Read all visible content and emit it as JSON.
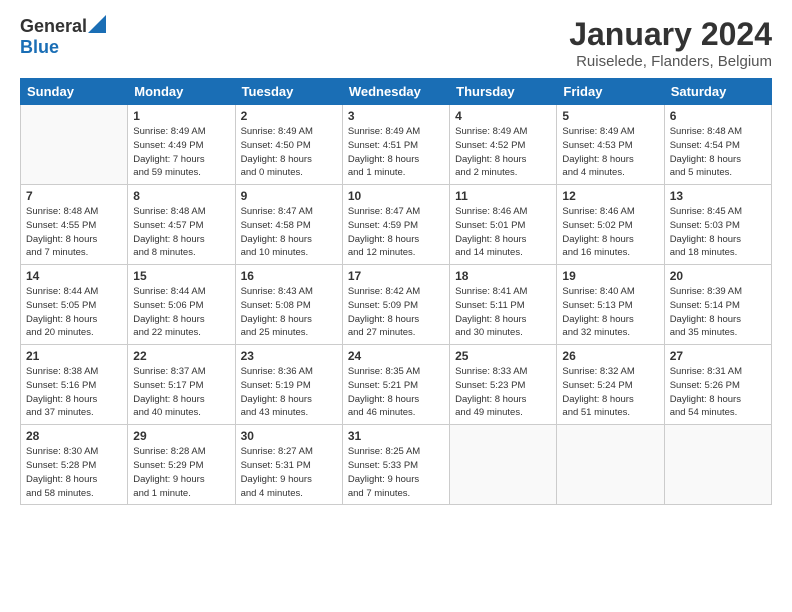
{
  "logo": {
    "line1": "General",
    "line2": "Blue"
  },
  "title": "January 2024",
  "subtitle": "Ruiselede, Flanders, Belgium",
  "days": [
    "Sunday",
    "Monday",
    "Tuesday",
    "Wednesday",
    "Thursday",
    "Friday",
    "Saturday"
  ],
  "weeks": [
    [
      {
        "day": "",
        "info": ""
      },
      {
        "day": "1",
        "info": "Sunrise: 8:49 AM\nSunset: 4:49 PM\nDaylight: 7 hours\nand 59 minutes."
      },
      {
        "day": "2",
        "info": "Sunrise: 8:49 AM\nSunset: 4:50 PM\nDaylight: 8 hours\nand 0 minutes."
      },
      {
        "day": "3",
        "info": "Sunrise: 8:49 AM\nSunset: 4:51 PM\nDaylight: 8 hours\nand 1 minute."
      },
      {
        "day": "4",
        "info": "Sunrise: 8:49 AM\nSunset: 4:52 PM\nDaylight: 8 hours\nand 2 minutes."
      },
      {
        "day": "5",
        "info": "Sunrise: 8:49 AM\nSunset: 4:53 PM\nDaylight: 8 hours\nand 4 minutes."
      },
      {
        "day": "6",
        "info": "Sunrise: 8:48 AM\nSunset: 4:54 PM\nDaylight: 8 hours\nand 5 minutes."
      }
    ],
    [
      {
        "day": "7",
        "info": "Sunrise: 8:48 AM\nSunset: 4:55 PM\nDaylight: 8 hours\nand 7 minutes."
      },
      {
        "day": "8",
        "info": "Sunrise: 8:48 AM\nSunset: 4:57 PM\nDaylight: 8 hours\nand 8 minutes."
      },
      {
        "day": "9",
        "info": "Sunrise: 8:47 AM\nSunset: 4:58 PM\nDaylight: 8 hours\nand 10 minutes."
      },
      {
        "day": "10",
        "info": "Sunrise: 8:47 AM\nSunset: 4:59 PM\nDaylight: 8 hours\nand 12 minutes."
      },
      {
        "day": "11",
        "info": "Sunrise: 8:46 AM\nSunset: 5:01 PM\nDaylight: 8 hours\nand 14 minutes."
      },
      {
        "day": "12",
        "info": "Sunrise: 8:46 AM\nSunset: 5:02 PM\nDaylight: 8 hours\nand 16 minutes."
      },
      {
        "day": "13",
        "info": "Sunrise: 8:45 AM\nSunset: 5:03 PM\nDaylight: 8 hours\nand 18 minutes."
      }
    ],
    [
      {
        "day": "14",
        "info": "Sunrise: 8:44 AM\nSunset: 5:05 PM\nDaylight: 8 hours\nand 20 minutes."
      },
      {
        "day": "15",
        "info": "Sunrise: 8:44 AM\nSunset: 5:06 PM\nDaylight: 8 hours\nand 22 minutes."
      },
      {
        "day": "16",
        "info": "Sunrise: 8:43 AM\nSunset: 5:08 PM\nDaylight: 8 hours\nand 25 minutes."
      },
      {
        "day": "17",
        "info": "Sunrise: 8:42 AM\nSunset: 5:09 PM\nDaylight: 8 hours\nand 27 minutes."
      },
      {
        "day": "18",
        "info": "Sunrise: 8:41 AM\nSunset: 5:11 PM\nDaylight: 8 hours\nand 30 minutes."
      },
      {
        "day": "19",
        "info": "Sunrise: 8:40 AM\nSunset: 5:13 PM\nDaylight: 8 hours\nand 32 minutes."
      },
      {
        "day": "20",
        "info": "Sunrise: 8:39 AM\nSunset: 5:14 PM\nDaylight: 8 hours\nand 35 minutes."
      }
    ],
    [
      {
        "day": "21",
        "info": "Sunrise: 8:38 AM\nSunset: 5:16 PM\nDaylight: 8 hours\nand 37 minutes."
      },
      {
        "day": "22",
        "info": "Sunrise: 8:37 AM\nSunset: 5:17 PM\nDaylight: 8 hours\nand 40 minutes."
      },
      {
        "day": "23",
        "info": "Sunrise: 8:36 AM\nSunset: 5:19 PM\nDaylight: 8 hours\nand 43 minutes."
      },
      {
        "day": "24",
        "info": "Sunrise: 8:35 AM\nSunset: 5:21 PM\nDaylight: 8 hours\nand 46 minutes."
      },
      {
        "day": "25",
        "info": "Sunrise: 8:33 AM\nSunset: 5:23 PM\nDaylight: 8 hours\nand 49 minutes."
      },
      {
        "day": "26",
        "info": "Sunrise: 8:32 AM\nSunset: 5:24 PM\nDaylight: 8 hours\nand 51 minutes."
      },
      {
        "day": "27",
        "info": "Sunrise: 8:31 AM\nSunset: 5:26 PM\nDaylight: 8 hours\nand 54 minutes."
      }
    ],
    [
      {
        "day": "28",
        "info": "Sunrise: 8:30 AM\nSunset: 5:28 PM\nDaylight: 8 hours\nand 58 minutes."
      },
      {
        "day": "29",
        "info": "Sunrise: 8:28 AM\nSunset: 5:29 PM\nDaylight: 9 hours\nand 1 minute."
      },
      {
        "day": "30",
        "info": "Sunrise: 8:27 AM\nSunset: 5:31 PM\nDaylight: 9 hours\nand 4 minutes."
      },
      {
        "day": "31",
        "info": "Sunrise: 8:25 AM\nSunset: 5:33 PM\nDaylight: 9 hours\nand 7 minutes."
      },
      {
        "day": "",
        "info": ""
      },
      {
        "day": "",
        "info": ""
      },
      {
        "day": "",
        "info": ""
      }
    ]
  ]
}
